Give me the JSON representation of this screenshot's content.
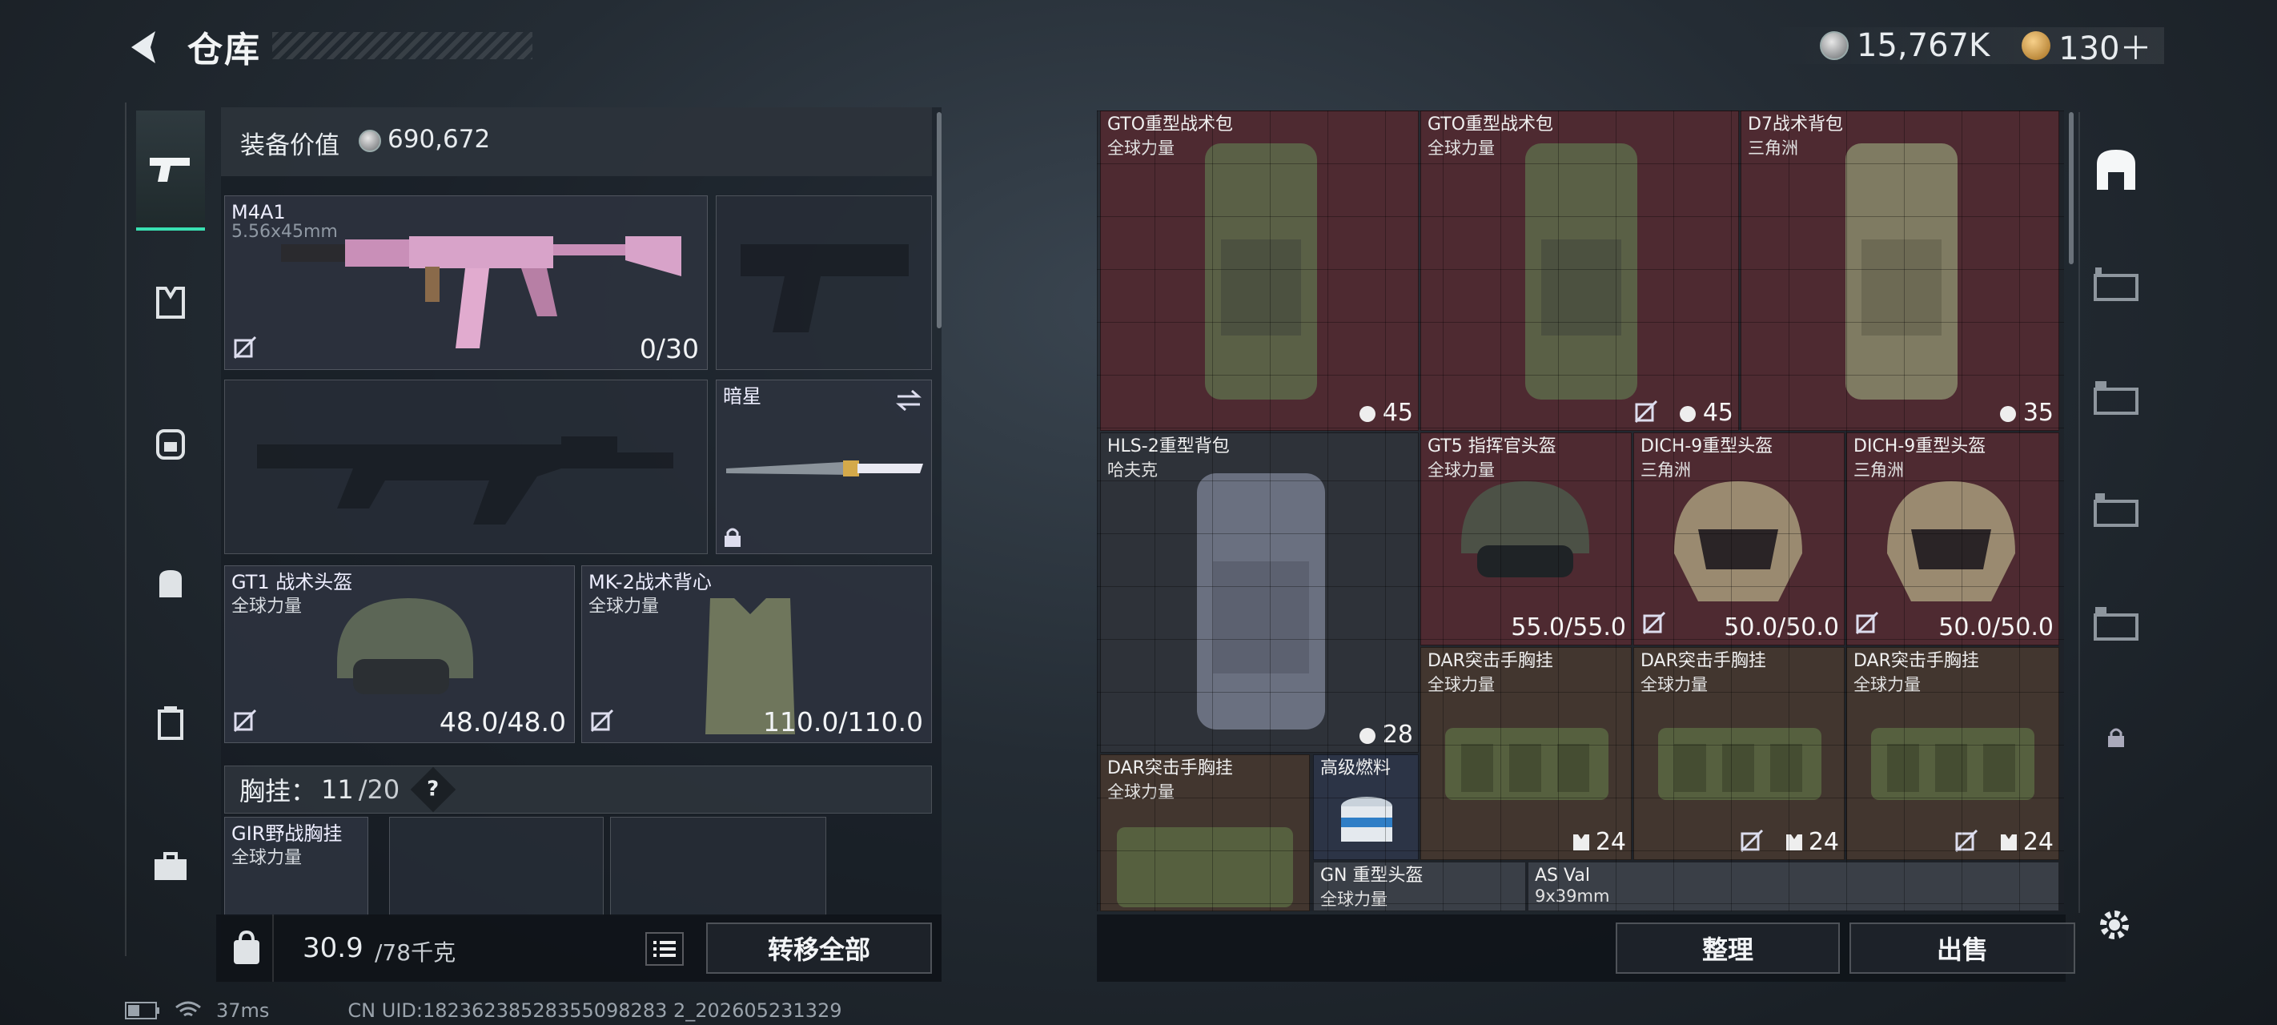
{
  "header": {
    "title": "仓库",
    "currency_amount": "15,767K",
    "token_amount": "130＋"
  },
  "equipment": {
    "value_label": "装备价值",
    "value": "690,672"
  },
  "slots": {
    "primary": {
      "name": "M4A1",
      "ammo": "5.56x45mm",
      "count": "0/30"
    },
    "melee": {
      "name": "暗星"
    },
    "helmet": {
      "name": "GT1 战术头盔",
      "faction": "全球力量",
      "durability": "48.0/48.0"
    },
    "armor": {
      "name": "MK-2战术背心",
      "faction": "全球力量",
      "durability": "110.0/110.0"
    }
  },
  "chestrig": {
    "label": "胸挂：",
    "used": "11",
    "capacity": "/20",
    "help": "?",
    "item": {
      "name": "GIR野战胸挂",
      "faction": "全球力量"
    }
  },
  "bottom_left": {
    "weight": "30.9",
    "weight_max": "/78千克",
    "transfer_all": "转移全部"
  },
  "grid_items": [
    {
      "name": "GTO重型战术包",
      "faction": "全球力量",
      "count": "45"
    },
    {
      "name": "GTO重型战术包",
      "faction": "全球力量",
      "count": "45"
    },
    {
      "name": "D7战术背包",
      "faction": "三角洲",
      "count": "35"
    },
    {
      "name": "HLS-2重型背包",
      "faction": "哈夫克",
      "count": "28"
    },
    {
      "name": "GT5 指挥官头盔",
      "faction": "全球力量",
      "count": "55.0/55.0"
    },
    {
      "name": "DICH-9重型头盔",
      "faction": "三角洲",
      "count": "50.0/50.0"
    },
    {
      "name": "DICH-9重型头盔",
      "faction": "三角洲",
      "count": "50.0/50.0"
    },
    {
      "name": "DAR突击手胸挂",
      "faction": "全球力量",
      "count": "24"
    },
    {
      "name": "DAR突击手胸挂",
      "faction": "全球力量",
      "count": "24"
    },
    {
      "name": "DAR突击手胸挂",
      "faction": "全球力量",
      "count": "24"
    },
    {
      "name": "DAR突击手胸挂",
      "faction": "全球力量",
      "count": ""
    },
    {
      "name": "高级燃料",
      "faction": "",
      "count": ""
    },
    {
      "name": "GN 重型头盔",
      "faction": "全球力量",
      "count": ""
    },
    {
      "name": "AS Val",
      "faction": "9x39mm",
      "count": ""
    }
  ],
  "actions": {
    "sort": "整理",
    "sell": "出售"
  },
  "status": {
    "ping": "37ms",
    "uid": "CN UID:18236238528355098283 2_202605231329"
  }
}
